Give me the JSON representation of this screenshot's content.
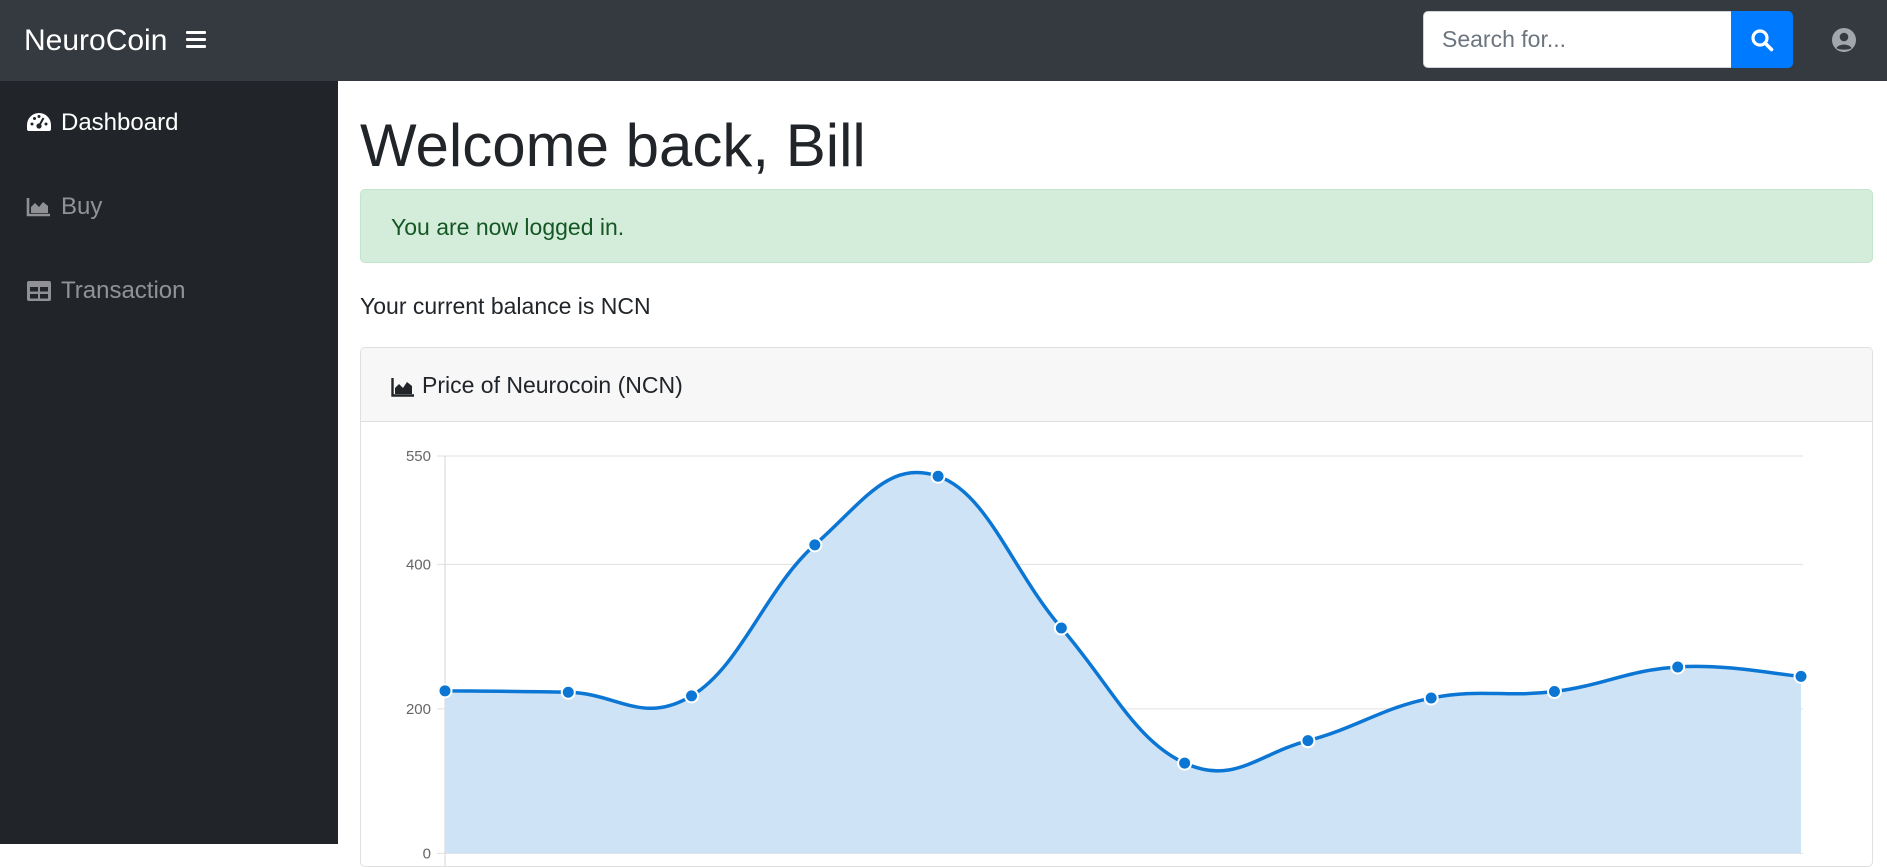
{
  "navbar": {
    "brand": "NeuroCoin",
    "search": {
      "placeholder": "Search for...",
      "value": ""
    }
  },
  "sidebar": {
    "items": [
      {
        "label": "Dashboard",
        "icon": "tachometer-icon",
        "active": true
      },
      {
        "label": "Buy",
        "icon": "area-chart-icon",
        "active": false
      },
      {
        "label": "Transaction",
        "icon": "table-icon",
        "active": false
      }
    ]
  },
  "main": {
    "welcome": "Welcome back, Bill",
    "alert": "You are now logged in.",
    "balance": "Your current balance is NCN",
    "card_title": "Price of Neurocoin (NCN)"
  },
  "colors": {
    "navbar": "#343a40",
    "sidebar": "#212529",
    "accent": "#007bff",
    "alert_bg": "#d4edda",
    "alert_text": "#155724",
    "line": "#0b76d3",
    "fill": "#cce1f6"
  },
  "chart_data": {
    "type": "area",
    "title": "",
    "xlabel": "",
    "ylabel": "",
    "y_ticks": [
      0,
      200,
      400,
      550
    ],
    "ylim": [
      0,
      550
    ],
    "grid": true,
    "series": [
      {
        "values": [
          225,
          223,
          218,
          427,
          522,
          312,
          125,
          156,
          215,
          224,
          258,
          245
        ]
      }
    ]
  }
}
